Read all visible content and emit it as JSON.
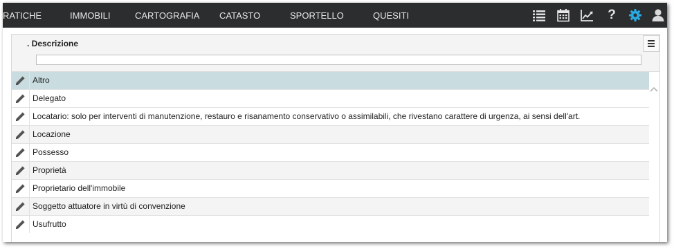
{
  "nav": {
    "items": [
      {
        "label": "RATICHE"
      },
      {
        "label": "IMMOBILI"
      },
      {
        "label": "CARTOGRAFIA"
      },
      {
        "label": "CATASTO"
      },
      {
        "label": "SPORTELLO"
      },
      {
        "label": "QUESITI"
      }
    ]
  },
  "toolbar": {
    "icons": [
      "list-icon",
      "calendar-icon",
      "chart-icon",
      "help-icon",
      "settings-icon",
      "user-icon"
    ],
    "help_glyph": "?",
    "accent_color": "#29a9df"
  },
  "grid": {
    "column_header": ". Descrizione",
    "filter_value": "",
    "selected_row_color": "#c9dde1",
    "rows": [
      {
        "label": "Altro",
        "selected": true
      },
      {
        "label": "Delegato"
      },
      {
        "label": "Locatario: solo per interventi di manutenzione, restauro e risanamento conservativo o assimilabili, che rivestano carattere di urgenza, ai sensi dell'art."
      },
      {
        "label": "Locazione"
      },
      {
        "label": "Possesso"
      },
      {
        "label": "Proprietà"
      },
      {
        "label": "Proprietario dell'immobile"
      },
      {
        "label": "Soggetto attuatore in virtù di convenzione"
      },
      {
        "label": "Usufrutto"
      }
    ]
  }
}
